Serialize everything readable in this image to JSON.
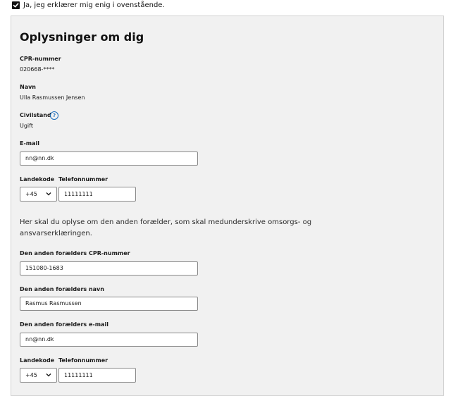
{
  "consent": {
    "label": "Ja, jeg erklærer mig enig i ovenstående.",
    "checked": true
  },
  "section": {
    "title": "Oplysninger om dig",
    "cpr": {
      "label": "CPR-nummer",
      "value": "020668-****"
    },
    "name": {
      "label": "Navn",
      "value": "Ulla Rasmussen Jensen"
    },
    "civil": {
      "label": "Civilstand",
      "value": "Ugift",
      "help_glyph": "?"
    },
    "email": {
      "label": "E-mail",
      "value": "nn@nn.dk"
    },
    "phone": {
      "country_label": "Landekode",
      "country_value": "+45",
      "number_label": "Telefonnummer",
      "number_value": "11111111"
    }
  },
  "other_parent": {
    "intro": "Her skal du oplyse om den anden forælder, som skal medunderskrive omsorgs- og ansvarserklæringen.",
    "cpr": {
      "label": "Den anden forælders CPR-nummer",
      "value": "151080-1683"
    },
    "name": {
      "label": "Den anden forælders navn",
      "value": "Rasmus Rasmussen"
    },
    "email": {
      "label": "Den anden forælders e-mail",
      "value": "nn@nn.dk"
    },
    "phone": {
      "country_label": "Landekode",
      "country_value": "+45",
      "number_label": "Telefonnummer",
      "number_value": "11111111"
    }
  },
  "colors": {
    "accent": "#1b6dbb",
    "panel_bg": "#f1f1f1",
    "border": "#8a8a8a"
  }
}
